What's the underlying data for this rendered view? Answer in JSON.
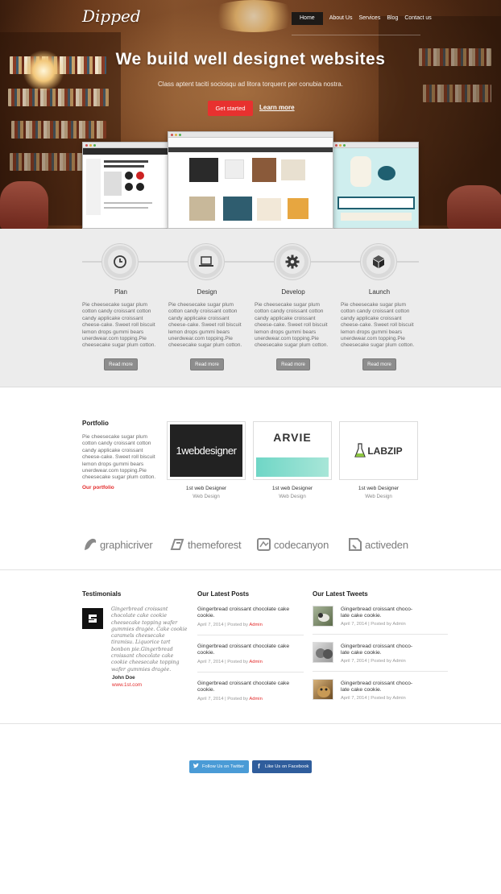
{
  "header": {
    "logo": "Dipped",
    "nav": [
      "Home",
      "About Us",
      "Services",
      "Blog",
      "Contact us"
    ]
  },
  "hero": {
    "title": "We build well designet websites",
    "subtitle": "Class aptent taciti sociosqu ad litora torquent per conubia nostra.",
    "cta_primary": "Get started",
    "cta_secondary": "Learn more"
  },
  "features": [
    {
      "title": "Plan",
      "icon": "clock-icon",
      "text": "Pie cheesecake sugar plum cotton candy croissant cotton candy applicake croissant cheese-cake. Sweet roll biscuit lemon drops gummi bears unerdwear.com topping.Pie cheesecake sugar plum cotton.",
      "button": "Read more"
    },
    {
      "title": "Design",
      "icon": "laptop-icon",
      "text": "Pie cheesecake sugar plum cotton candy croissant cotton candy applicake croissant cheese-cake. Sweet roll biscuit lemon drops gummi bears unerdwear.com topping.Pie cheesecake sugar plum cotton.",
      "button": "Read more"
    },
    {
      "title": "Develop",
      "icon": "gear-icon",
      "text": "Pie cheesecake sugar plum cotton candy croissant cotton candy applicake croissant cheese-cake. Sweet roll biscuit lemon drops gummi bears unerdwear.com topping.Pie cheesecake sugar plum cotton.",
      "button": "Read more"
    },
    {
      "title": "Launch",
      "icon": "cube-icon",
      "text": "Pie cheesecake sugar plum cotton candy croissant cotton candy applicake croissant cheese-cake. Sweet roll biscuit lemon drops gummi bears unerdwear.com topping.Pie cheesecake sugar plum cotton.",
      "button": "Read more"
    }
  ],
  "portfolio": {
    "title": "Portfolio",
    "text": "Pie cheesecake sugar plum cotton candy croissant cotton candy applicake croissant cheese-cake. Sweet roll biscuit lemon drops gummi bears unerdwear.com topping.Pie cheesecake sugar plum cotton.",
    "link": "Our portfolio",
    "items": [
      {
        "logo": "1webdesigner",
        "caption": "1st web Designer",
        "category": "Web Design"
      },
      {
        "logo": "ARVIE",
        "caption": "1st web Designer",
        "category": "Web Design"
      },
      {
        "logo": "LABZIP",
        "caption": "1st web Designer",
        "category": "Web Design"
      }
    ]
  },
  "brands": [
    "graphicriver",
    "themeforest",
    "codecanyon",
    "activeden"
  ],
  "testimonials": {
    "title": "Testimonials",
    "quote": "Gingerbread croissant chocolate cake cookie cheesecake topping wafer gummies dragée. Cake cookie caramels cheesecake tiramisu. Liquorice tart bonbon pie.Gingerbread croissant chocolate cake cookie cheesecake topping wafer gummies dragée.",
    "name": "John Doe",
    "site": "www.1st.com"
  },
  "posts": {
    "title": "Our Latest Posts",
    "items": [
      {
        "title": "Gingerbread croissant chocolate cake cookie.",
        "date": "April 7, 2014 | Posted by ",
        "author": "Admin"
      },
      {
        "title": "Gingerbread croissant chocolate cake cookie.",
        "date": "April 7, 2014 | Posted by ",
        "author": "Admin"
      },
      {
        "title": "Gingerbread croissant chocolate cake cookie.",
        "date": "April 7, 2014 | Posted by ",
        "author": "Admin"
      }
    ]
  },
  "tweets": {
    "title": "Our Latest Tweets",
    "items": [
      {
        "title": "Gingerbread croissant choco-late cake cookie.",
        "meta": "April 7, 2014 | Posted by Admin"
      },
      {
        "title": "Gingerbread croissant choco-late cake cookie.",
        "meta": "April 7, 2014 | Posted by Admin"
      },
      {
        "title": "Gingerbread croissant choco-late cake cookie.",
        "meta": "April 7, 2014 | Posted by Admin"
      }
    ]
  },
  "social": {
    "twitter": "Follow Us on Twitter",
    "facebook": "Like Us on Facebook"
  },
  "colors": {
    "accent": "#e8312f",
    "twitter": "#4a9bd6",
    "facebook": "#2f5d9c",
    "button_gray": "#8d8d8d"
  }
}
